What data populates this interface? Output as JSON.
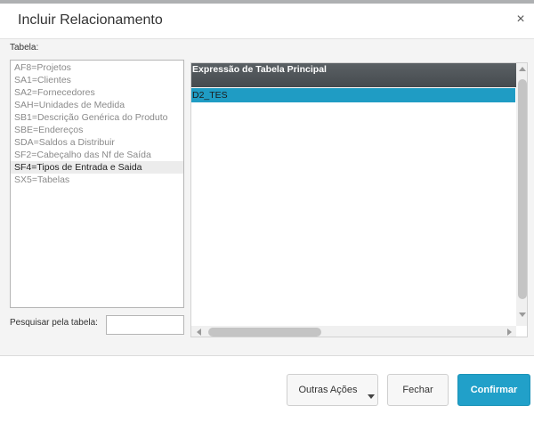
{
  "dialog": {
    "title": "Incluir Relacionamento",
    "close_glyph": "×"
  },
  "left_panel": {
    "label": "Tabela:",
    "items": [
      "AF8=Projetos",
      "SA1=Clientes",
      "SA2=Fornecedores",
      "SAH=Unidades de Medida",
      "SB1=Descrição Genérica do Produto",
      "SBE=Endereços",
      "SDA=Saldos a Distribuir",
      "SF2=Cabeçalho das Nf de Saída",
      "SF4=Tipos de Entrada e Saida",
      "SX5=Tabelas"
    ],
    "selected_item": "SF4=Tipos de Entrada e Saida",
    "search_label": "Pesquisar pela tabela:",
    "search_value": ""
  },
  "grid": {
    "header": "Expressão de Tabela Principal",
    "rows": [
      "D2_TES"
    ]
  },
  "footer": {
    "outras_acoes": "Outras Ações",
    "fechar": "Fechar",
    "confirmar": "Confirmar"
  },
  "colors": {
    "accent": "#21a0c9",
    "selected_row": "#1f9cc4",
    "header_bg": "#4e5357"
  }
}
